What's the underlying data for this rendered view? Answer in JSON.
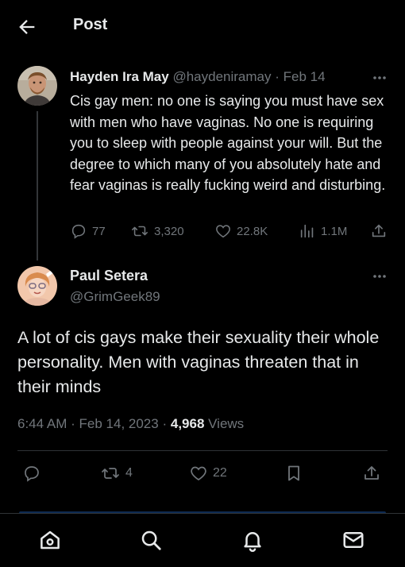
{
  "header": {
    "title": "Post"
  },
  "quoted_post": {
    "author_name": "Hayden Ira May",
    "handle": "@haydeniramay",
    "separator": "·",
    "date": "Feb 14",
    "text": "Cis gay men: no one is saying you must have sex with men who have vaginas. No one is requiring you to sleep with people against your will. But the degree to which many of you absolutely hate and fear vaginas is really fucking weird and disturbing.",
    "replies": "77",
    "reposts": "3,320",
    "likes": "22.8K",
    "views": "1.1M"
  },
  "main_post": {
    "author_name": "Paul Setera",
    "handle": "@GrimGeek89",
    "text": "A lot of cis gays make their sexuality their whole personality. Men with vaginas threaten that in their minds",
    "time": "6:44 AM",
    "dot": "·",
    "date": "Feb 14, 2023",
    "dot2": "·",
    "views_count": "4,968",
    "views_label": "Views",
    "reposts": "4",
    "likes": "22"
  },
  "colors": {
    "background": "#000000",
    "text": "#e7e9ea",
    "muted": "#71767b",
    "divider": "#2f3336"
  },
  "icons": [
    "back-arrow-icon",
    "more-icon",
    "reply-icon",
    "repost-icon",
    "like-icon",
    "views-icon",
    "share-icon",
    "bookmark-icon",
    "home-icon",
    "search-icon",
    "notifications-icon",
    "messages-icon"
  ]
}
